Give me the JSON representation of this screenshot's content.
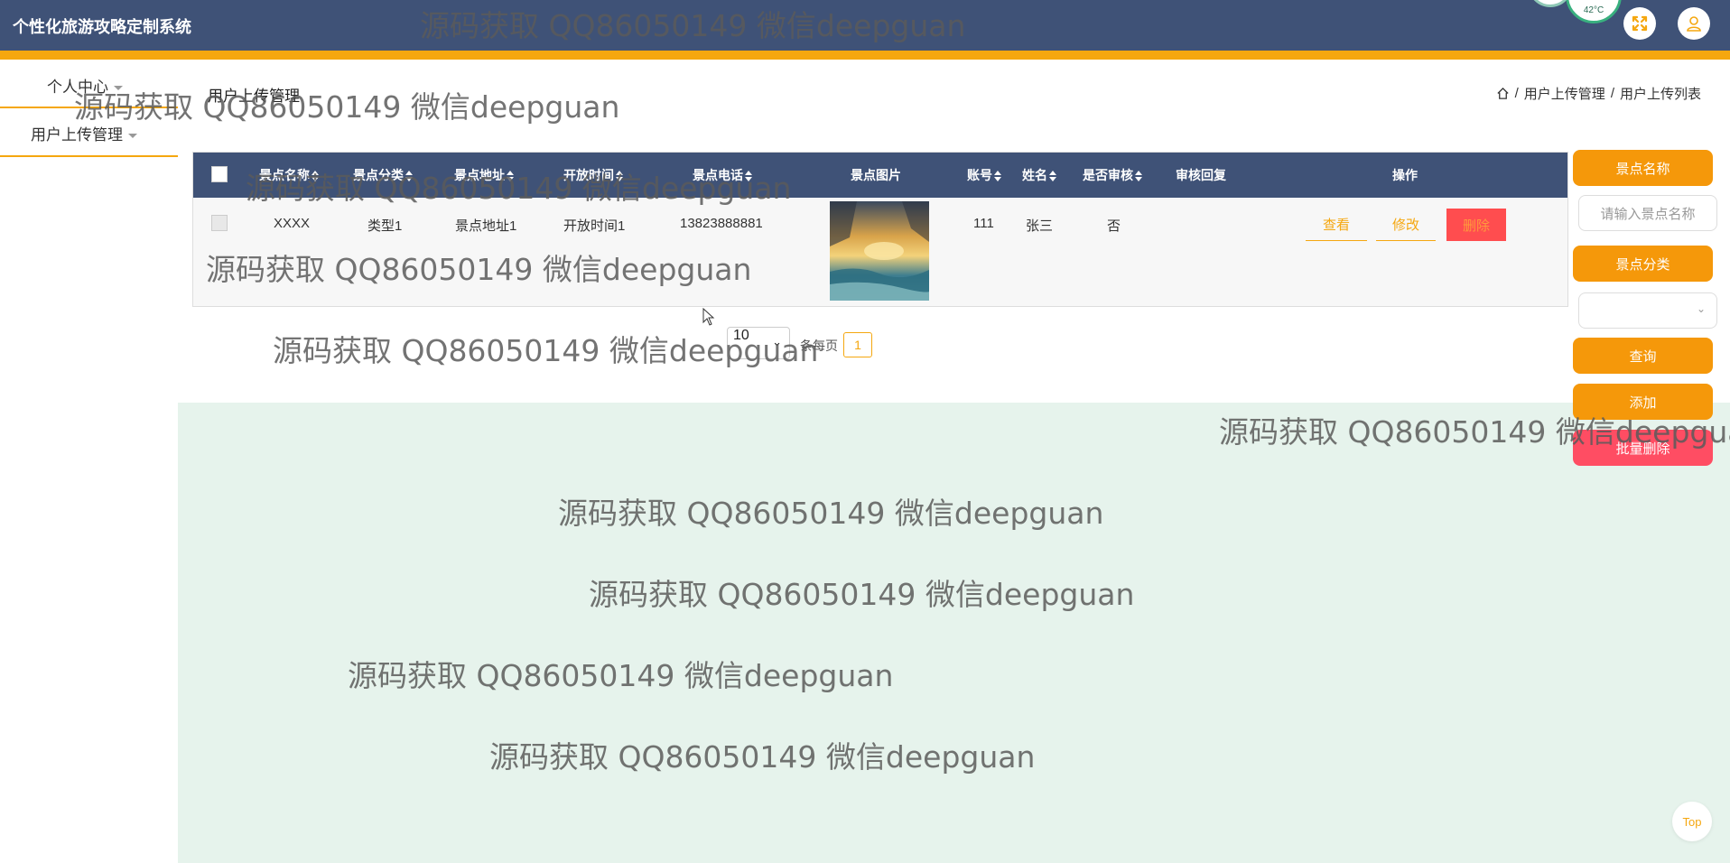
{
  "app": {
    "title": "个性化旅游攻略定制系统"
  },
  "header": {
    "weather_text": "42°C",
    "icons": [
      "fullscreen-icon",
      "user-icon"
    ]
  },
  "sidebar": {
    "items": [
      {
        "label": "个人中心"
      },
      {
        "label": "用户上传管理"
      }
    ]
  },
  "page": {
    "title": "用户上传管理",
    "breadcrumb": [
      "用户上传管理",
      "用户上传列表"
    ]
  },
  "table": {
    "headers": [
      "景点名称",
      "景点分类",
      "景点地址",
      "开放时间",
      "景点电话",
      "景点图片",
      "账号",
      "姓名",
      "是否审核",
      "审核回复",
      "操作"
    ],
    "rows": [
      {
        "name": "XXXX",
        "category": "类型1",
        "address": "景点地址1",
        "open_time": "开放时间1",
        "phone": "13823888881",
        "account": "111",
        "realname": "张三",
        "reviewed": "否",
        "reply": "",
        "actions": {
          "view": "查看",
          "edit": "修改",
          "delete": "删除"
        }
      }
    ]
  },
  "pagination": {
    "page_size": "10",
    "per_page_label": "条每页",
    "current_page": "1"
  },
  "search_panel": {
    "name_label": "景点名称",
    "name_placeholder": "请输入景点名称",
    "category_label": "景点分类",
    "category_value": "",
    "query_button": "查询",
    "add_button": "添加",
    "batch_delete_button": "批量删除"
  },
  "top_button": "Top",
  "watermark": "源码获取 QQ86050149 微信deepguan",
  "colors": {
    "header": "#3f5277",
    "accent": "#f5a70f",
    "orange_button": "#f5980a",
    "danger": "#ff4d4f",
    "content_bg": "#e6f3ec"
  }
}
